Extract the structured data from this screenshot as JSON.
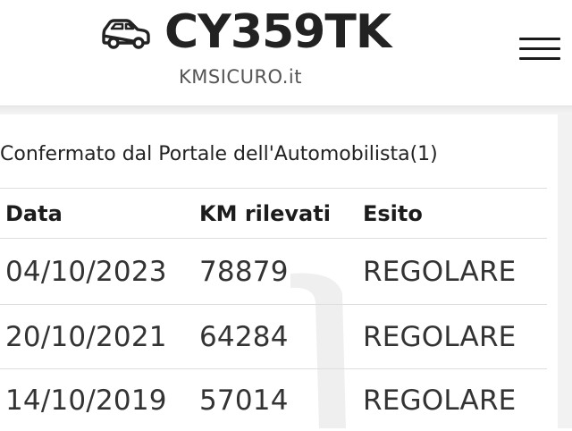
{
  "header": {
    "plate": "CY359TK",
    "car_icon": "car-icon",
    "subtitle": "KMSICURO.it",
    "menu_icon": "hamburger-menu-icon"
  },
  "section": {
    "title": "Confermato dal Portale dell'Automobilista(1)"
  },
  "table": {
    "columns": [
      "Data",
      "KM rilevati",
      "Esito"
    ],
    "rows": [
      [
        "04/10/2023",
        "78879",
        "REGOLARE"
      ],
      [
        "20/10/2021",
        "64284",
        "REGOLARE"
      ],
      [
        "14/10/2019",
        "57014",
        "REGOLARE"
      ]
    ]
  }
}
